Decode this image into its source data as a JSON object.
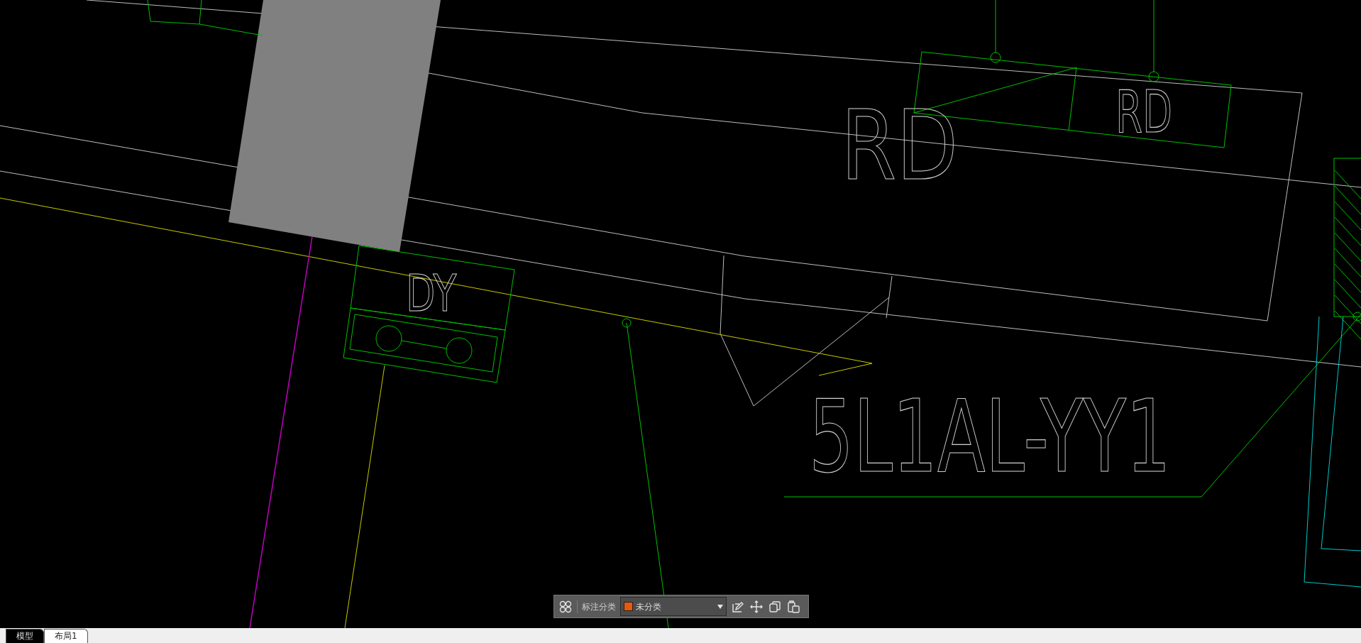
{
  "drawing_labels": [
    {
      "text": "RD"
    },
    {
      "text": "RD"
    },
    {
      "text": "DY"
    },
    {
      "text": "5L1AL-YY1"
    }
  ],
  "annotation_toolbar": {
    "label": "标注分类",
    "category": {
      "value": "未分类",
      "color": "#e8580c"
    }
  },
  "layout_tabs": [
    {
      "label": "模型",
      "selected": true
    },
    {
      "label": "布局1",
      "selected": false
    }
  ]
}
